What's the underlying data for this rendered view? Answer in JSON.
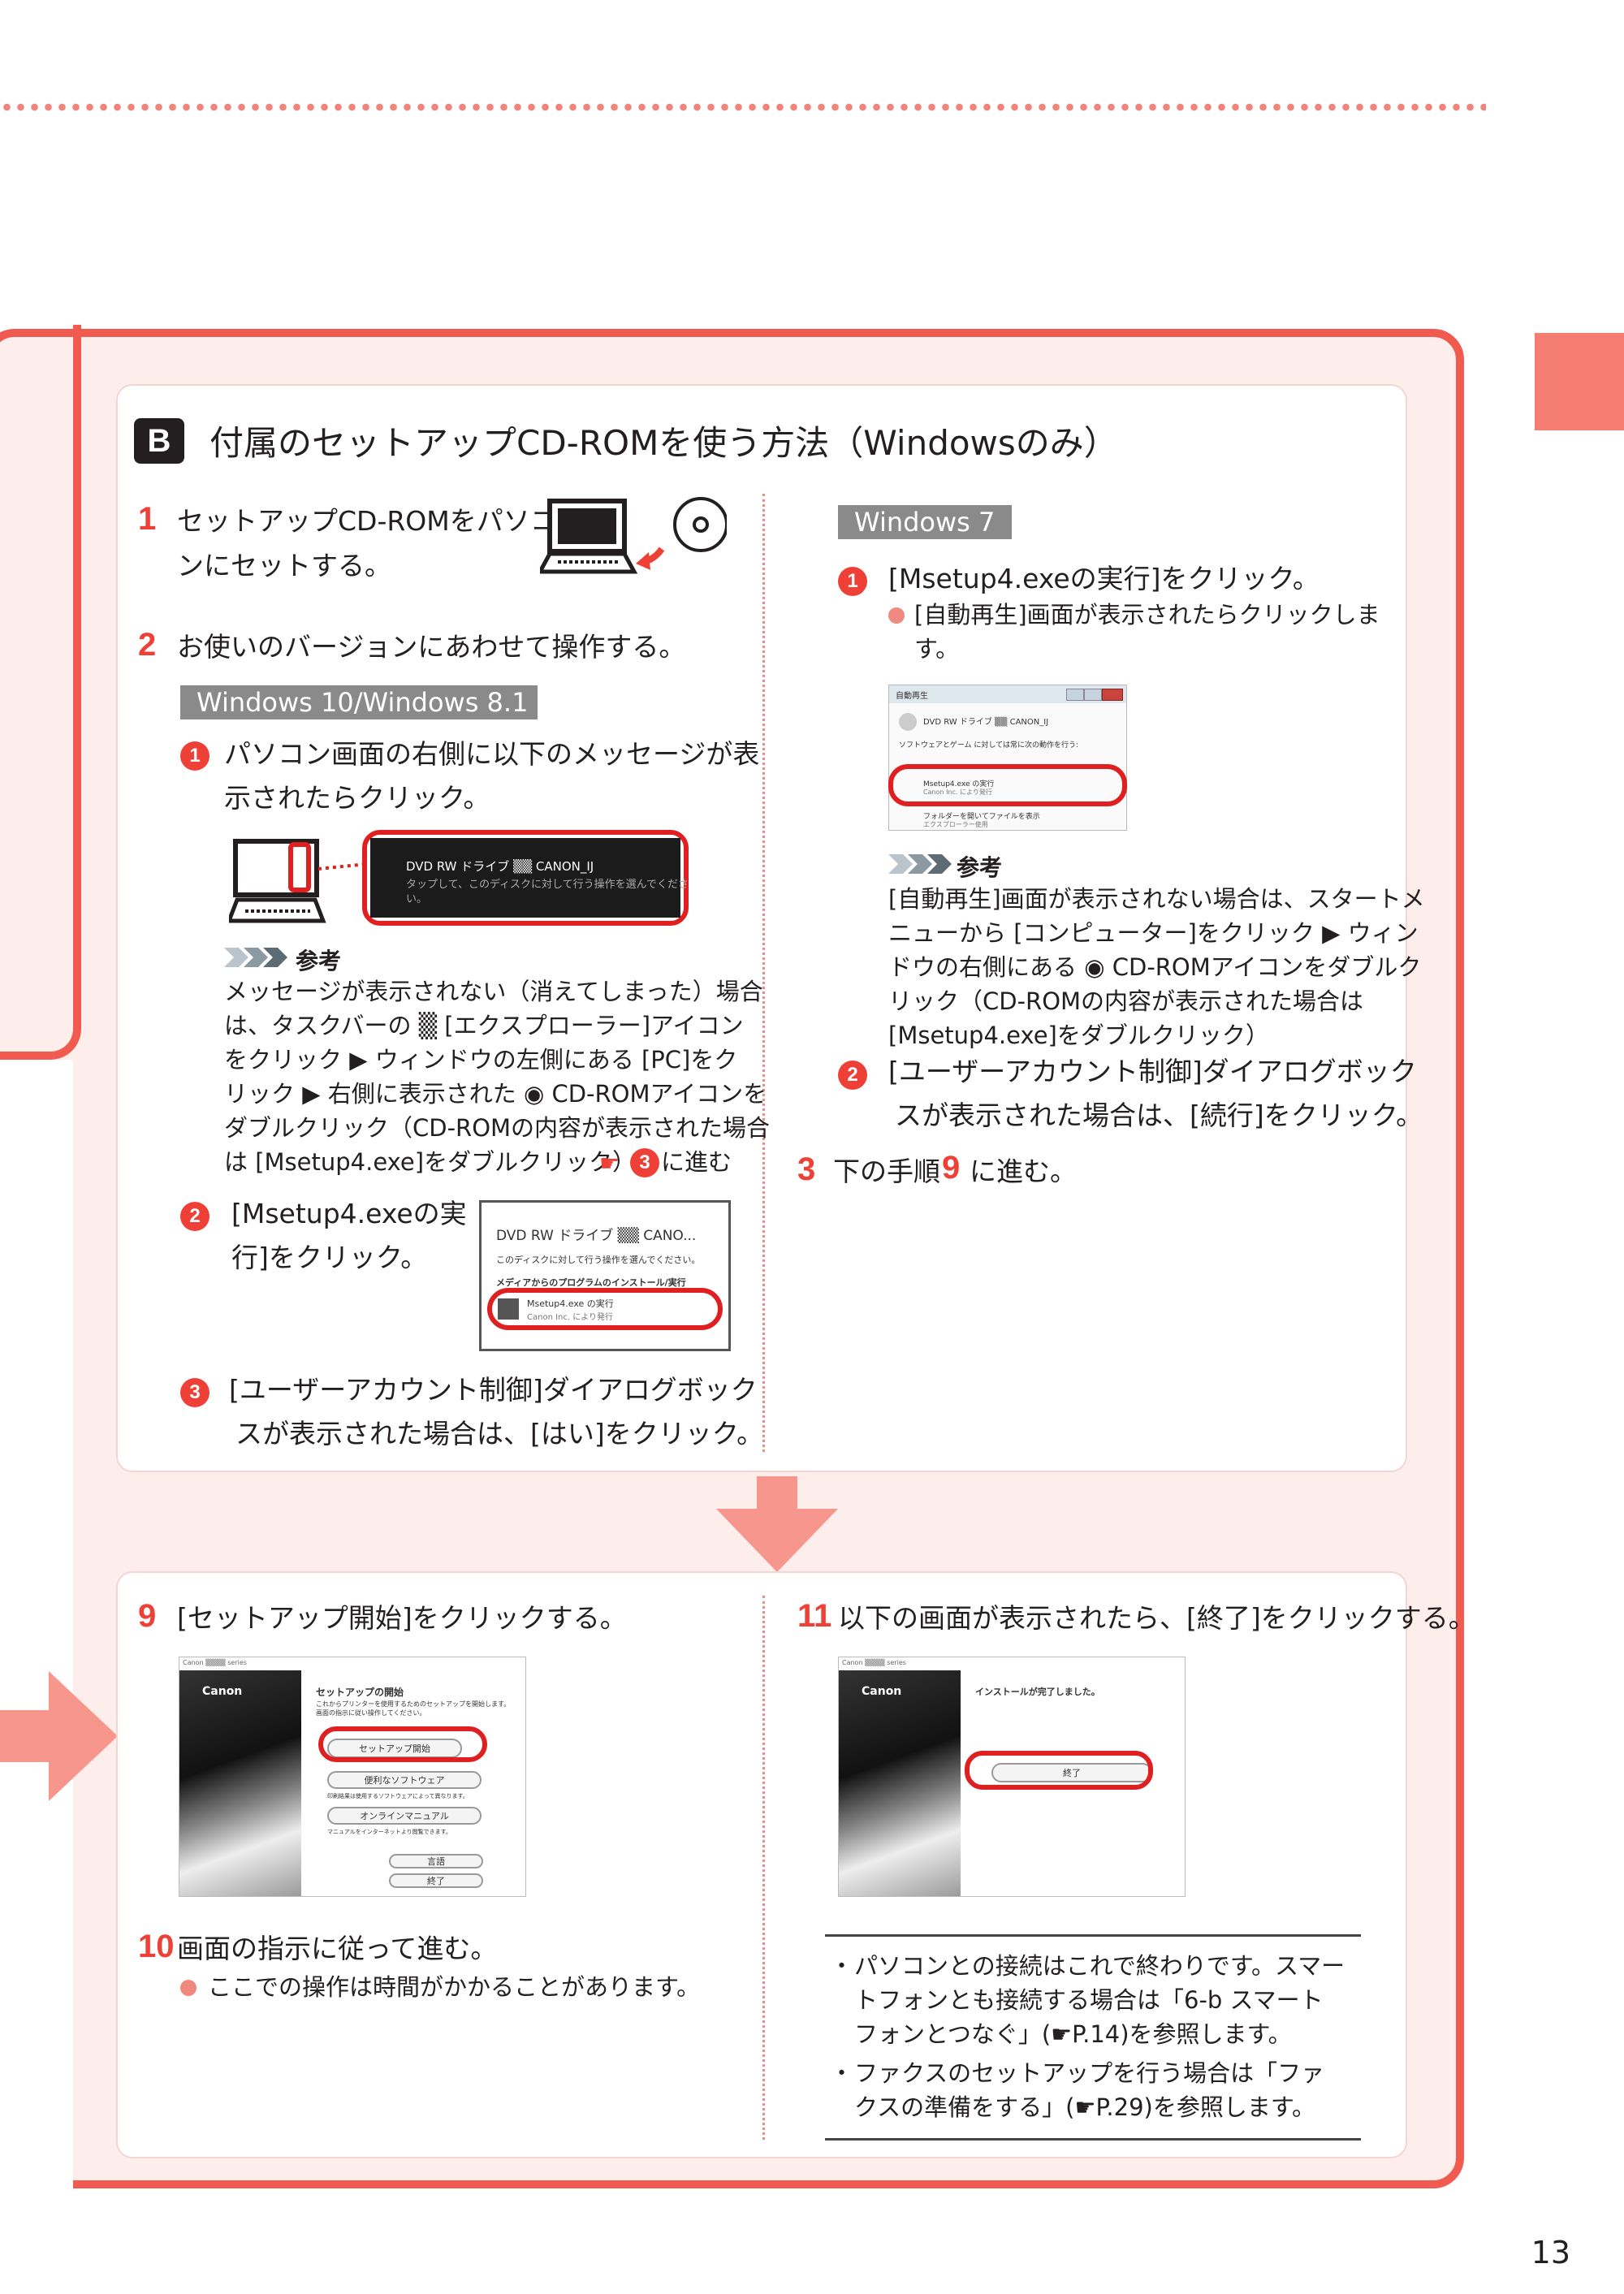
{
  "page_number": "13",
  "section": {
    "badge": "B",
    "title": "付属のセットアップCD-ROMを使う方法（Windowsのみ）"
  },
  "step1": {
    "num": "1",
    "line1": "セットアップCD-ROMをパソコ",
    "line2": "ンにセットする。"
  },
  "step2": {
    "num": "2",
    "text": "お使いのバージョンにあわせて操作する。"
  },
  "win10": {
    "label": "Windows 10/Windows 8.1",
    "s1": {
      "num": "1",
      "line1": "パソコン画面の右側に以下のメッセージが表",
      "line2": "示されたらクリック。"
    },
    "toast": {
      "title": "DVD RW ドライブ ▒▒ CANON_IJ",
      "sub": "タップして、このディスクに対して行う操作を選んでくださ",
      "sub2": "い。"
    },
    "note": {
      "header": "参考",
      "lines": [
        "メッセージが表示されない（消えてしまった）場合",
        "は、タスクバーの ▒ [エクスプローラー]アイコン",
        "をクリック ▶ ウィンドウの左側にある [PC]をク",
        "リック ▶ 右側に表示された ◉ CD-ROMアイコンを",
        "ダブルクリック（CD-ROMの内容が表示された場合",
        "は [Msetup4.exe]をダブルクリック）"
      ],
      "goto_num": "3",
      "goto_text": "に進む"
    },
    "s2": {
      "num": "2",
      "line1": "[Msetup4.exeの実",
      "line2": "行]をクリック。"
    },
    "dialog": {
      "title": "DVD RW ドライブ ▒▒ CANO...",
      "l1": "このディスクに対して行う操作を選んでください。",
      "l2": "メディアからのプログラムのインストール/実行",
      "item": "Msetup4.exe の実行",
      "item_sub": "Canon Inc. により発行"
    },
    "s3": {
      "num": "3",
      "line1": "[ユーザーアカウント制御]ダイアログボック",
      "line2": "スが表示された場合は、[はい]をクリック。"
    }
  },
  "win7": {
    "label": "Windows 7",
    "s1": {
      "num": "1",
      "text": "[Msetup4.exeの実行]をクリック。",
      "bullet1": "[自動再生]画面が表示されたらクリックしま",
      "bullet2": "す。"
    },
    "autoplay": {
      "title": "自動再生",
      "drive": "DVD RW ドライブ ▒▒ CANON_IJ",
      "check": "ソフトウェアとゲーム に対しては常に次の動作を行う:",
      "item": "Msetup4.exe の実行",
      "item_sub": "Canon Inc. により発行",
      "folder": "フォルダーを開いてファイルを表示",
      "folder_sub": "エクスプローラー使用"
    },
    "note": {
      "header": "参考",
      "lines": [
        "[自動再生]画面が表示されない場合は、スタートメ",
        "ニューから [コンピューター]をクリック ▶ ウィン",
        "ドウの右側にある ◉ CD-ROMアイコンをダブルク",
        "リック（CD-ROMの内容が表示された場合は",
        "[Msetup4.exe]をダブルクリック）"
      ]
    },
    "s2": {
      "num": "2",
      "line1": "[ユーザーアカウント制御]ダイアログボック",
      "line2": "スが表示された場合は、[続行]をクリック。"
    }
  },
  "step3": {
    "num": "3",
    "pre": "下の手順",
    "target": "9",
    "post": "に進む。"
  },
  "step9": {
    "num": "9",
    "text": "[セットアップ開始]をクリックする。"
  },
  "setup_screen": {
    "header": "Canon ▒▒▒▒ series",
    "logo": "Canon",
    "title": "セットアップの開始",
    "desc1": "これからプリンターを使用するためのセットアップを開始します。",
    "desc2": "画面の指示に従い操作してください。",
    "btn_start": "セットアップ開始",
    "btn_soft": "便利なソフトウェア",
    "soft_desc": "印刷結果は使用するソフトウェアによって異なります。",
    "btn_manual": "オンラインマニュアル",
    "manual_desc": "マニュアルをインターネットより閲覧できます。",
    "btn_lang": "言語",
    "btn_exit": "終了"
  },
  "step10": {
    "num": "10",
    "text": "画面の指示に従って進む。",
    "bullet": "ここでの操作は時間がかかることがあります。"
  },
  "step11": {
    "num": "11",
    "text": "以下の画面が表示されたら、[終了]をクリックする。"
  },
  "finish_screen": {
    "header": "Canon ▒▒▒▒ series",
    "logo": "Canon",
    "msg": "インストールが完了しました。",
    "btn": "終了"
  },
  "info": {
    "b1_l1": "パソコンとの接続はこれで終わりです。スマー",
    "b1_l2": "トフォンとも接続する場合は「6-b スマート",
    "b1_l3": "フォンとつなぐ」(☛P.14)を参照します。",
    "b2_l1": "ファクスのセットアップを行う場合は「ファ",
    "b2_l2": "クスの準備をする」(☛P.29)を参照します。"
  },
  "colors": {
    "accent": "#ee4036",
    "frame": "#f15a4f",
    "panel_bg": "#fdeeec",
    "arrow": "#f7968c",
    "label_gray": "#8a8a8a"
  }
}
